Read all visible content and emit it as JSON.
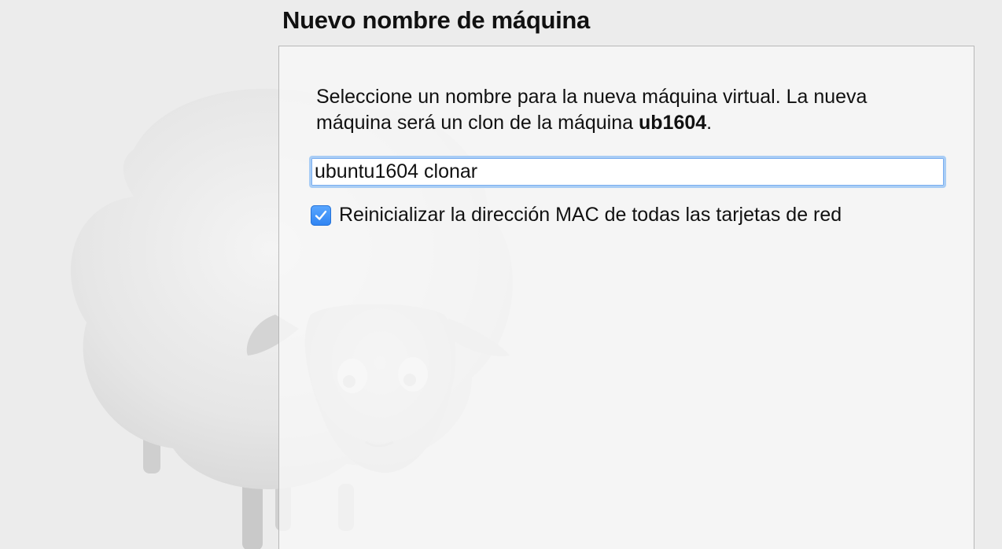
{
  "header": {
    "title": "Nuevo nombre de máquina"
  },
  "panel": {
    "description_prefix": "Seleccione un nombre para la nueva máquina virtual. La nueva máquina será un clon de la máquina ",
    "source_machine": "ub1604",
    "description_suffix": "."
  },
  "name_input": {
    "value": "ubuntu1604 clonar"
  },
  "mac_option": {
    "label": "Reinicializar la dirección MAC de todas las tarjetas de red",
    "checked": true,
    "icon": "checkmark-icon"
  },
  "background": {
    "illustration": "sheep-icon"
  },
  "colors": {
    "accent": "#3b8ff5",
    "focus_ring": "#a9cdf5",
    "window_bg": "#ececec",
    "panel_bg": "#f7f7f7"
  }
}
